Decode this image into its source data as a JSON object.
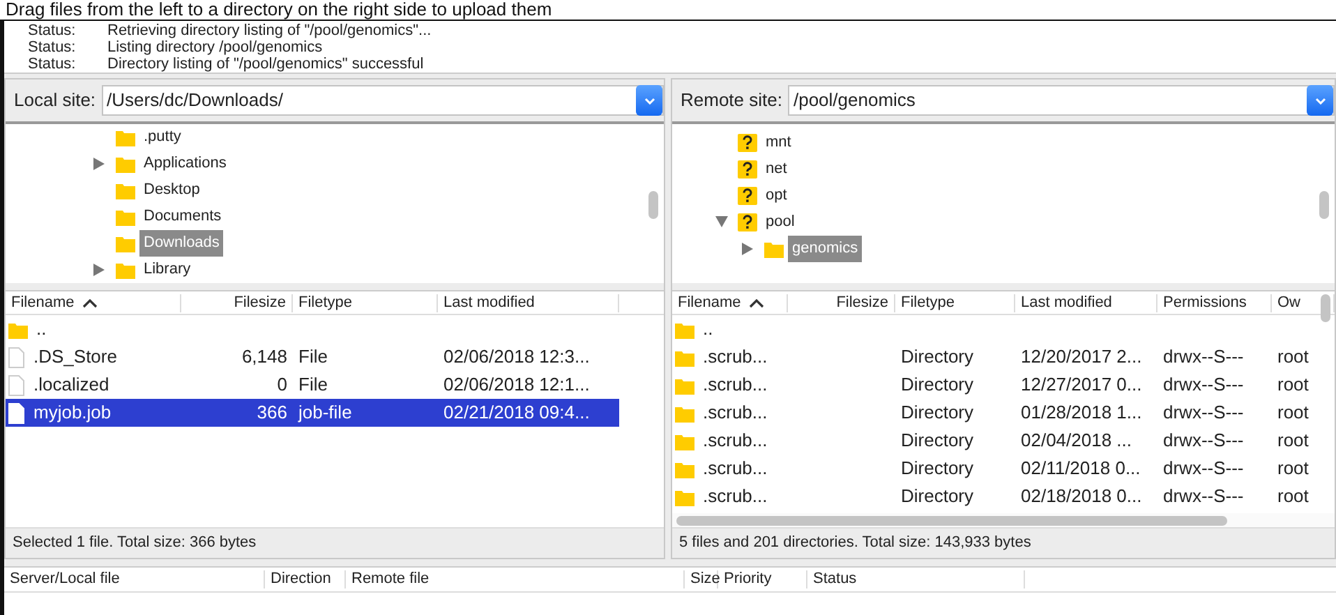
{
  "caption": "Drag files from the left to a directory on the right side to upload them",
  "log": [
    {
      "label": "Status:",
      "message": "Retrieving directory listing of \"/pool/genomics\"..."
    },
    {
      "label": "Status:",
      "message": "Listing directory /pool/genomics"
    },
    {
      "label": "Status:",
      "message": "Directory listing of \"/pool/genomics\" successful"
    }
  ],
  "panes": [
    {
      "site_label": "Local site:",
      "path": "/Users/dc/Downloads/",
      "tree": [
        {
          "label": ".putty",
          "kind": "folder",
          "expandable": false,
          "expanded": false,
          "selected": false
        },
        {
          "label": "Applications",
          "kind": "folder",
          "expandable": true,
          "expanded": false,
          "selected": false
        },
        {
          "label": "Desktop",
          "kind": "folder",
          "expandable": false,
          "expanded": false,
          "selected": false
        },
        {
          "label": "Documents",
          "kind": "folder",
          "expandable": false,
          "expanded": false,
          "selected": false
        },
        {
          "label": "Downloads",
          "kind": "folder",
          "expandable": false,
          "expanded": false,
          "selected": true
        },
        {
          "label": "Library",
          "kind": "folder",
          "expandable": true,
          "expanded": false,
          "selected": false
        }
      ],
      "columns": [
        {
          "label": "Filename",
          "sorted": true
        },
        {
          "label": "Filesize",
          "sorted": false
        },
        {
          "label": "Filetype",
          "sorted": false
        },
        {
          "label": "Last modified",
          "sorted": false
        }
      ],
      "rows": [
        {
          "kind": "folder",
          "selected": false,
          "cells": [
            ".."
          ]
        },
        {
          "kind": "file",
          "selected": false,
          "cells": [
            ".DS_Store",
            "6,148",
            "File",
            "02/06/2018 12:3..."
          ]
        },
        {
          "kind": "file",
          "selected": false,
          "cells": [
            ".localized",
            "0",
            "File",
            "02/06/2018 12:1..."
          ]
        },
        {
          "kind": "file",
          "selected": true,
          "cells": [
            "myjob.job",
            "366",
            "job-file",
            "02/21/2018 09:4..."
          ]
        }
      ],
      "status": "Selected 1 file. Total size: 366 bytes"
    },
    {
      "site_label": "Remote site:",
      "path": "/pool/genomics",
      "tree": [
        {
          "label": "mnt",
          "kind": "unknown",
          "expandable": false,
          "expanded": false,
          "selected": false
        },
        {
          "label": "net",
          "kind": "unknown",
          "expandable": false,
          "expanded": false,
          "selected": false
        },
        {
          "label": "opt",
          "kind": "unknown",
          "expandable": false,
          "expanded": false,
          "selected": false
        },
        {
          "label": "pool",
          "kind": "unknown",
          "expandable": true,
          "expanded": true,
          "selected": false,
          "children": [
            {
              "label": "genomics",
              "kind": "folder",
              "expandable": true,
              "expanded": false,
              "selected": true
            }
          ]
        }
      ],
      "columns": [
        {
          "label": "Filename",
          "sorted": true
        },
        {
          "label": "Filesize",
          "sorted": false
        },
        {
          "label": "Filetype",
          "sorted": false
        },
        {
          "label": "Last modified",
          "sorted": false
        },
        {
          "label": "Permissions",
          "sorted": false
        },
        {
          "label": "Ow",
          "sorted": false
        }
      ],
      "rows": [
        {
          "kind": "folder",
          "selected": false,
          "cells": [
            ".."
          ]
        },
        {
          "kind": "folder",
          "selected": false,
          "cells": [
            ".scrub...",
            "",
            "Directory",
            "12/20/2017 2...",
            "drwx--S---",
            "root"
          ]
        },
        {
          "kind": "folder",
          "selected": false,
          "cells": [
            ".scrub...",
            "",
            "Directory",
            "12/27/2017 0...",
            "drwx--S---",
            "root"
          ]
        },
        {
          "kind": "folder",
          "selected": false,
          "cells": [
            ".scrub...",
            "",
            "Directory",
            "01/28/2018 1...",
            "drwx--S---",
            "root"
          ]
        },
        {
          "kind": "folder",
          "selected": false,
          "cells": [
            ".scrub...",
            "",
            "Directory",
            "02/04/2018 ...",
            "drwx--S---",
            "root"
          ]
        },
        {
          "kind": "folder",
          "selected": false,
          "cells": [
            ".scrub...",
            "",
            "Directory",
            "02/11/2018 0...",
            "drwx--S---",
            "root"
          ]
        },
        {
          "kind": "folder",
          "selected": false,
          "cells": [
            ".scrub...",
            "",
            "Directory",
            "02/18/2018 0...",
            "drwx--S---",
            "root"
          ]
        }
      ],
      "status": "5 files and 201 directories. Total size: 143,933 bytes"
    }
  ],
  "queue": {
    "columns": [
      "Server/Local file",
      "Direction",
      "Remote file",
      "Size",
      "Priority",
      "Status"
    ]
  }
}
